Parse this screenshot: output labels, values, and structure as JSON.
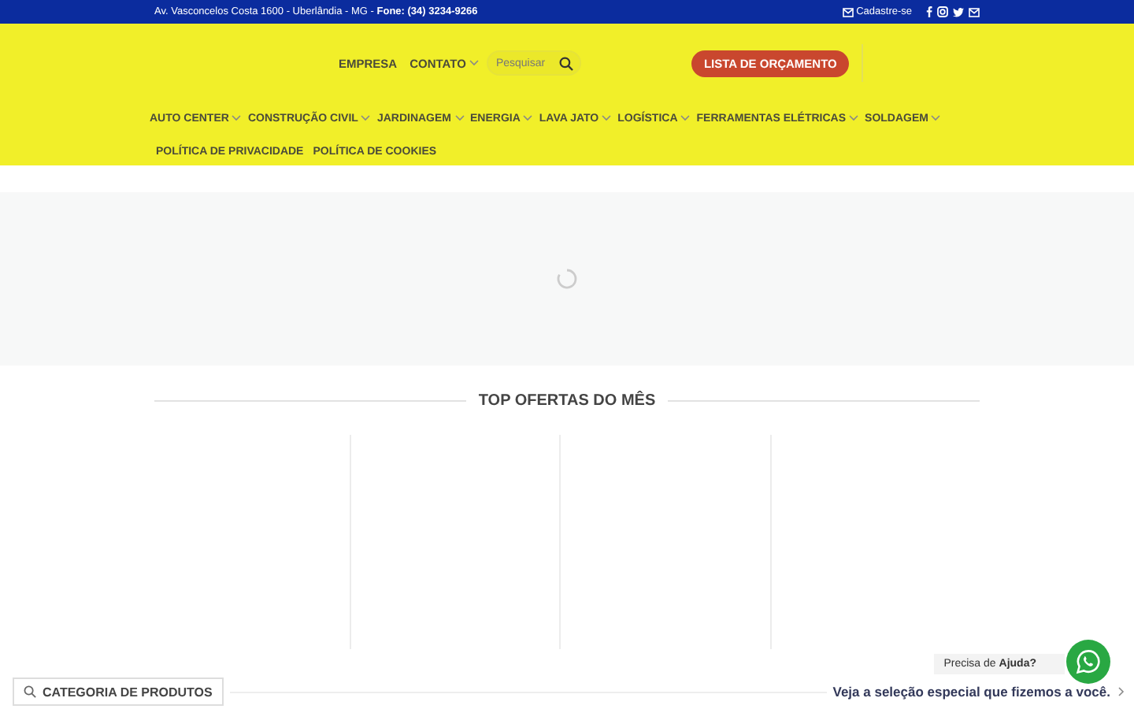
{
  "top_bar": {
    "contact": "Av. Vasconcelos Costa 1600 - Uberlândia - MG - **Fone: (34) 3234-9266**",
    "signup": "Cadastre-se"
  },
  "header": {
    "links": [
      {
        "label": "EMPRESA",
        "has_dropdown": false
      },
      {
        "label": "CONTATO",
        "has_dropdown": true
      }
    ],
    "search": {
      "placeholder": "Pesquisar"
    },
    "quote_button": "LISTA DE ORÇAMENTO"
  },
  "nav": [
    {
      "label": "AUTO CENTER",
      "has_dropdown": true
    },
    {
      "label": "CONSTRUÇÃO CIVIL",
      "has_dropdown": true
    },
    {
      "label": "JARDINAGEM",
      "has_dropdown": true
    },
    {
      "label": "ENERGIA",
      "has_dropdown": true
    },
    {
      "label": "LAVA JATO",
      "has_dropdown": true
    },
    {
      "label": "LOGÍSTICA",
      "has_dropdown": true
    },
    {
      "label": "FERRAMENTAS ELÉTRICAS",
      "has_dropdown": true
    },
    {
      "label": "SOLDAGEM",
      "has_dropdown": true
    },
    {
      "label": "POLÍTICA DE PRIVACIDADE",
      "has_dropdown": false
    },
    {
      "label": "POLÍTICA DE COOKIES",
      "has_dropdown": false
    }
  ],
  "section_title": "TOP OFERTAS DO MÊS",
  "bottom": {
    "category_button": "CATEGORIA DE PRODUTOS",
    "promo": "Veja a seleção especial que fizemos a você."
  },
  "chat": {
    "prompt": "Precisa de **Ajuda?**"
  }
}
